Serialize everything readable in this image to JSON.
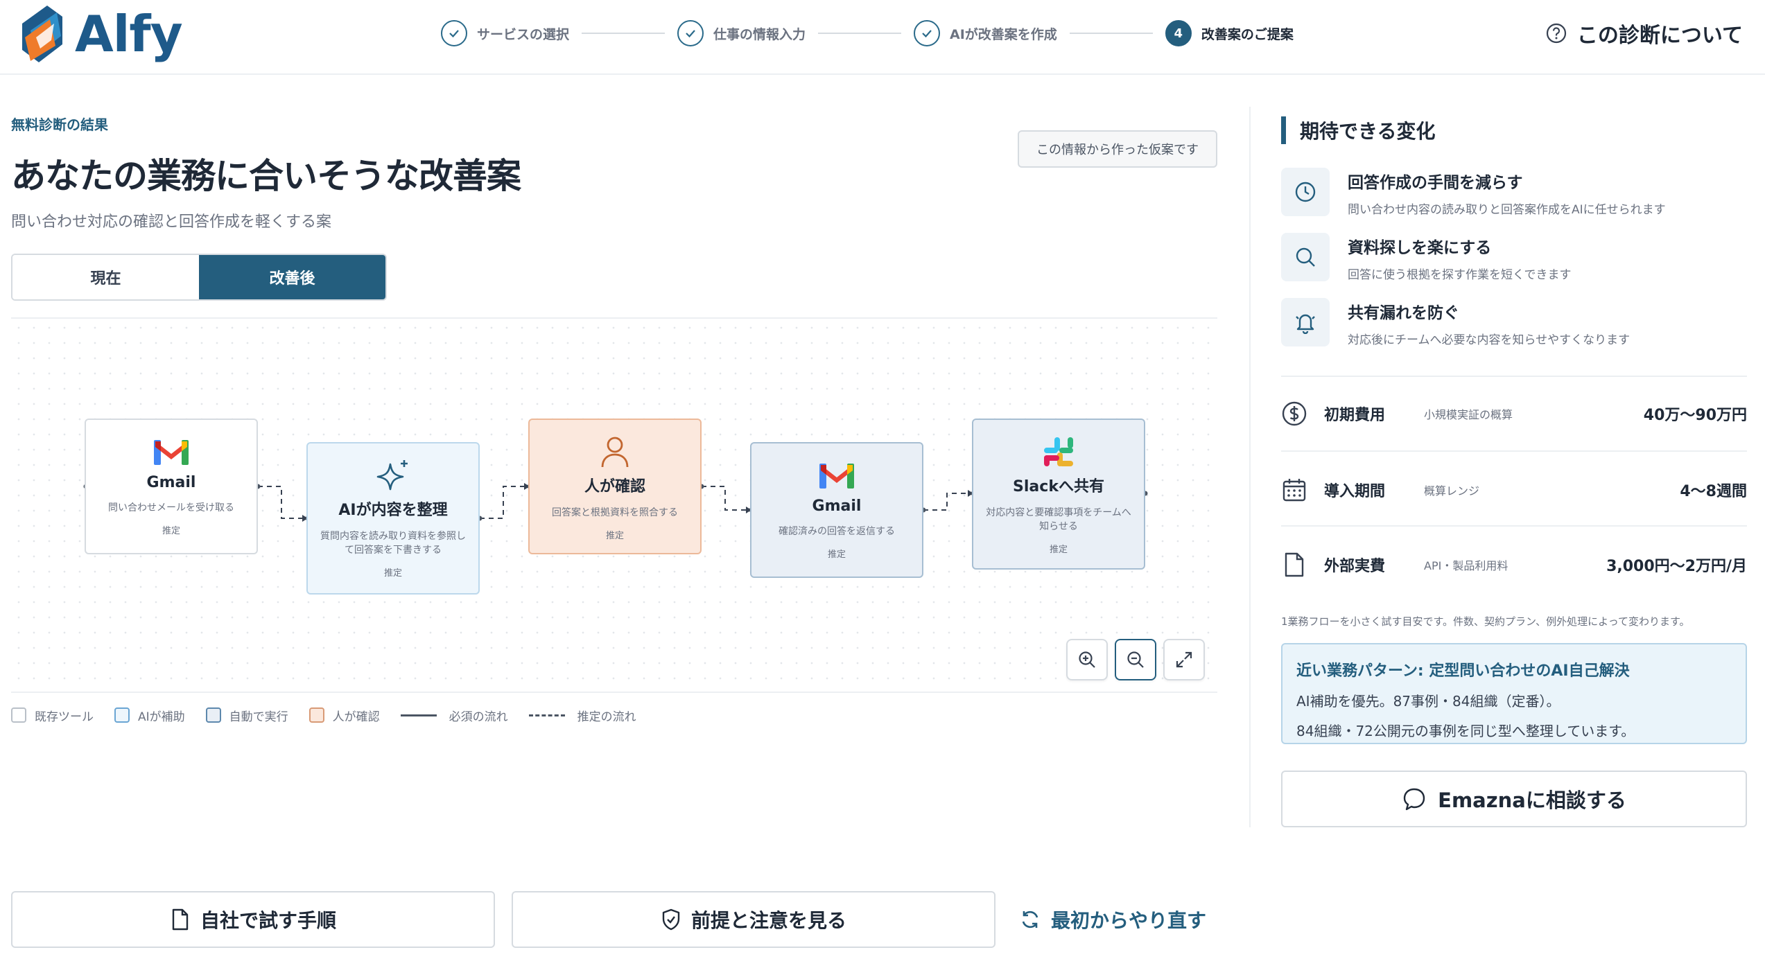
{
  "brand": {
    "name": "Alfy"
  },
  "header": {
    "steps": [
      {
        "label": "サービスの選択",
        "status": "done"
      },
      {
        "label": "仕事の情報入力",
        "status": "done"
      },
      {
        "label": "AIが改善案を作成",
        "status": "done"
      },
      {
        "label": "改善案のご提案",
        "status": "active",
        "number": "4"
      }
    ],
    "about_label": "この診断について"
  },
  "main": {
    "eyebrow": "無料診断の結果",
    "title": "あなたの業務に合いそうな改善案",
    "subtitle": "問い合わせ対応の確認と回答作成を軽くする案",
    "hypothesis_badge": "この情報から作った仮案です",
    "toggle": {
      "current": "現在",
      "improved": "改善後",
      "selected": "改善後"
    }
  },
  "flow": {
    "nodes": [
      {
        "kind": "tool",
        "icon": "gmail-icon",
        "title": "Gmail",
        "desc": "問い合わせメールを受け取る",
        "tag": "推定"
      },
      {
        "kind": "ai",
        "icon": "sparkle-icon",
        "title": "AIが内容を整理",
        "desc": "質問内容を読み取り資料を参照して回答案を下書きする",
        "tag": "推定"
      },
      {
        "kind": "human",
        "icon": "person-icon",
        "title": "人が確認",
        "desc": "回答案と根拠資料を照合する",
        "tag": "推定"
      },
      {
        "kind": "auto",
        "icon": "gmail-icon",
        "title": "Gmail",
        "desc": "確認済みの回答を返信する",
        "tag": "推定"
      },
      {
        "kind": "auto",
        "icon": "slack-icon",
        "title": "Slackへ共有",
        "desc": "対応内容と要確認事項をチームへ知らせる",
        "tag": "推定"
      }
    ],
    "controls": [
      "zoom-in-icon",
      "zoom-out-icon",
      "fullscreen-icon"
    ]
  },
  "legend": [
    {
      "label": "既存ツール",
      "color": "#b9c0c8"
    },
    {
      "label": "AIが補助",
      "color": "#6aa5d3"
    },
    {
      "label": "自動で実行",
      "color": "#5d88ad"
    },
    {
      "label": "人が確認",
      "color": "#d89a76"
    },
    {
      "label": "必須の流れ",
      "style": "solid"
    },
    {
      "label": "推定の流れ",
      "style": "dashed"
    }
  ],
  "actions": {
    "try_steps": "自社で試す手順",
    "assumptions": "前提と注意を見る",
    "restart": "最初からやり直す"
  },
  "panel": {
    "title": "期待できる変化",
    "benefits": [
      {
        "icon": "clock-icon",
        "title": "回答作成の手間を減らす",
        "desc": "問い合わせ内容の読み取りと回答案作成をAIに任せられます"
      },
      {
        "icon": "search-icon",
        "title": "資料探しを楽にする",
        "desc": "回答に使う根拠を探す作業を短くできます"
      },
      {
        "icon": "bell-icon",
        "title": "共有漏れを防ぐ",
        "desc": "対応後にチームへ必要な内容を知らせやすくなります"
      }
    ],
    "metrics": [
      {
        "icon": "dollar-icon",
        "label": "初期費用",
        "note": "小規模実証の概算",
        "value": "40万〜90万円"
      },
      {
        "icon": "calendar-icon",
        "label": "導入期間",
        "note": "概算レンジ",
        "value": "4〜8週間"
      },
      {
        "icon": "document-icon",
        "label": "外部実費",
        "note": "API・製品利用料",
        "value": "3,000円〜2万円/月"
      }
    ],
    "footnote": "1業務フローを小さく試す目安です。件数、契約プラン、例外処理によって変わります。",
    "pattern": {
      "title": "近い業務パターン: 定型問い合わせのAI自己解決",
      "line1": "AI補助を優先。87事例・84組織（定番）。",
      "line2": "84組織・72公開元の事例を同じ型へ整理しています。"
    },
    "consult_label": "Emaznaに相談する"
  },
  "colors": {
    "accent": "#245e7e",
    "ai_bg": "#eef6fc",
    "human_bg": "#fbe8dd",
    "auto_bg": "#e9eff6"
  }
}
